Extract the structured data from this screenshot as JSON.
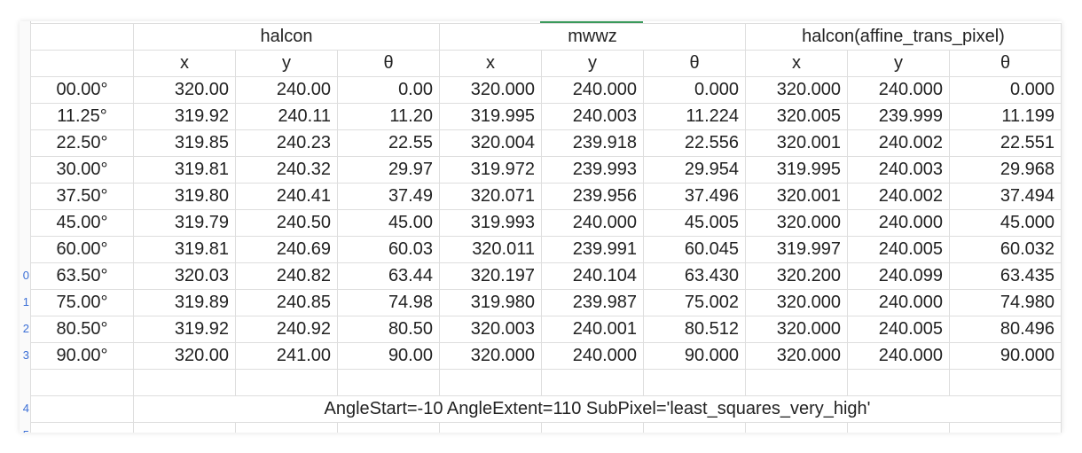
{
  "header_groups": [
    {
      "label": "halcon"
    },
    {
      "label": "mwwz"
    },
    {
      "label": "halcon(affine_trans_pixel)"
    }
  ],
  "subheaders": [
    "x",
    "y",
    "θ",
    "x",
    "y",
    "θ",
    "x",
    "y",
    "θ"
  ],
  "rows": [
    {
      "angle": "00.00°",
      "values": [
        "320.00",
        "240.00",
        "0.00",
        "320.000",
        "240.000",
        "0.000",
        "320.000",
        "240.000",
        "0.000"
      ]
    },
    {
      "angle": "11.25°",
      "values": [
        "319.92",
        "240.11",
        "11.20",
        "319.995",
        "240.003",
        "11.224",
        "320.005",
        "239.999",
        "11.199"
      ]
    },
    {
      "angle": "22.50°",
      "values": [
        "319.85",
        "240.23",
        "22.55",
        "320.004",
        "239.918",
        "22.556",
        "320.001",
        "240.002",
        "22.551"
      ]
    },
    {
      "angle": "30.00°",
      "values": [
        "319.81",
        "240.32",
        "29.97",
        "319.972",
        "239.993",
        "29.954",
        "319.995",
        "240.003",
        "29.968"
      ]
    },
    {
      "angle": "37.50°",
      "values": [
        "319.80",
        "240.41",
        "37.49",
        "320.071",
        "239.956",
        "37.496",
        "320.001",
        "240.002",
        "37.494"
      ]
    },
    {
      "angle": "45.00°",
      "values": [
        "319.79",
        "240.50",
        "45.00",
        "319.993",
        "240.000",
        "45.005",
        "320.000",
        "240.000",
        "45.000"
      ]
    },
    {
      "angle": "60.00°",
      "values": [
        "319.81",
        "240.69",
        "60.03",
        "320.011",
        "239.991",
        "60.045",
        "319.997",
        "240.005",
        "60.032"
      ]
    },
    {
      "angle": "63.50°",
      "values": [
        "320.03",
        "240.82",
        "63.44",
        "320.197",
        "240.104",
        "63.430",
        "320.200",
        "240.099",
        "63.435"
      ]
    },
    {
      "angle": "75.00°",
      "values": [
        "319.89",
        "240.85",
        "74.98",
        "319.980",
        "239.987",
        "75.002",
        "320.000",
        "240.000",
        "74.980"
      ]
    },
    {
      "angle": "80.50°",
      "values": [
        "319.92",
        "240.92",
        "80.50",
        "320.003",
        "240.001",
        "80.512",
        "320.000",
        "240.005",
        "80.496"
      ]
    },
    {
      "angle": "90.00°",
      "values": [
        "320.00",
        "241.00",
        "90.00",
        "320.000",
        "240.000",
        "90.000",
        "320.000",
        "240.000",
        "90.000"
      ]
    }
  ],
  "note": "AngleStart=-10  AngleExtent=110  SubPixel='least_squares_very_high'",
  "colors": {
    "grid": "#dedede",
    "selection_accent": "#3a9a5b",
    "row_marker": "#3b6fd6"
  }
}
